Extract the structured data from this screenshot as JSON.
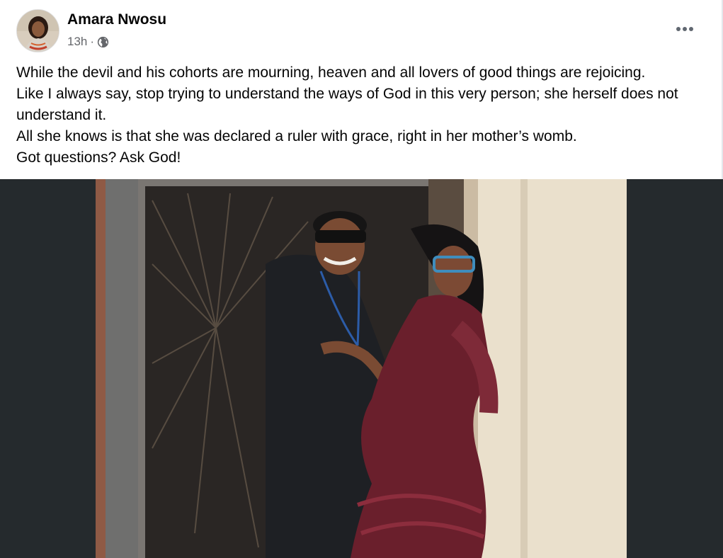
{
  "post": {
    "author": {
      "name": "Amara Nwosu",
      "avatar_icon": "profile-photo"
    },
    "timestamp": "13h",
    "separator": "·",
    "audience_icon": "globe-icon",
    "menu_icon": "more-horizontal-icon",
    "text_lines": [
      "While the devil and his cohorts are mourning, heaven and all lovers of good things are rejoicing.",
      "Like I always say, stop trying to understand the ways of God in this very person; she herself does not understand it.",
      "All she knows is that she was declared a ruler with grace, right in her mother’s womb.",
      "Got questions? Ask God!"
    ],
    "photo": {
      "subject": "photo-man-and-woman-embracing",
      "background_color": "#252a2d"
    }
  }
}
